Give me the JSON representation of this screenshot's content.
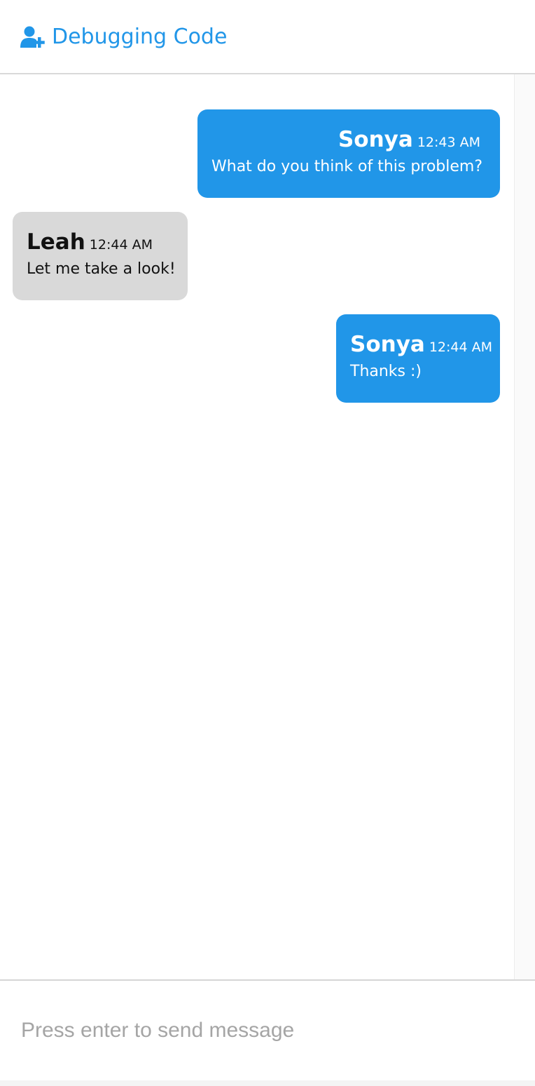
{
  "header": {
    "title": "Debugging Code",
    "icon": "add-user-icon",
    "accent_color": "#2196e8"
  },
  "messages": [
    {
      "sender": "Sonya",
      "time": "12:43 AM",
      "text": "What do you think of this problem?",
      "direction": "sent"
    },
    {
      "sender": "Leah",
      "time": "12:44 AM",
      "text": "Let me take a look!",
      "direction": "received"
    },
    {
      "sender": "Sonya",
      "time": "12:44 AM",
      "text": "Thanks :)",
      "direction": "sent"
    }
  ],
  "composer": {
    "placeholder": "Press enter to send message",
    "value": ""
  },
  "colors": {
    "sent_bubble": "#2196e8",
    "received_bubble": "#d9d9d9"
  }
}
